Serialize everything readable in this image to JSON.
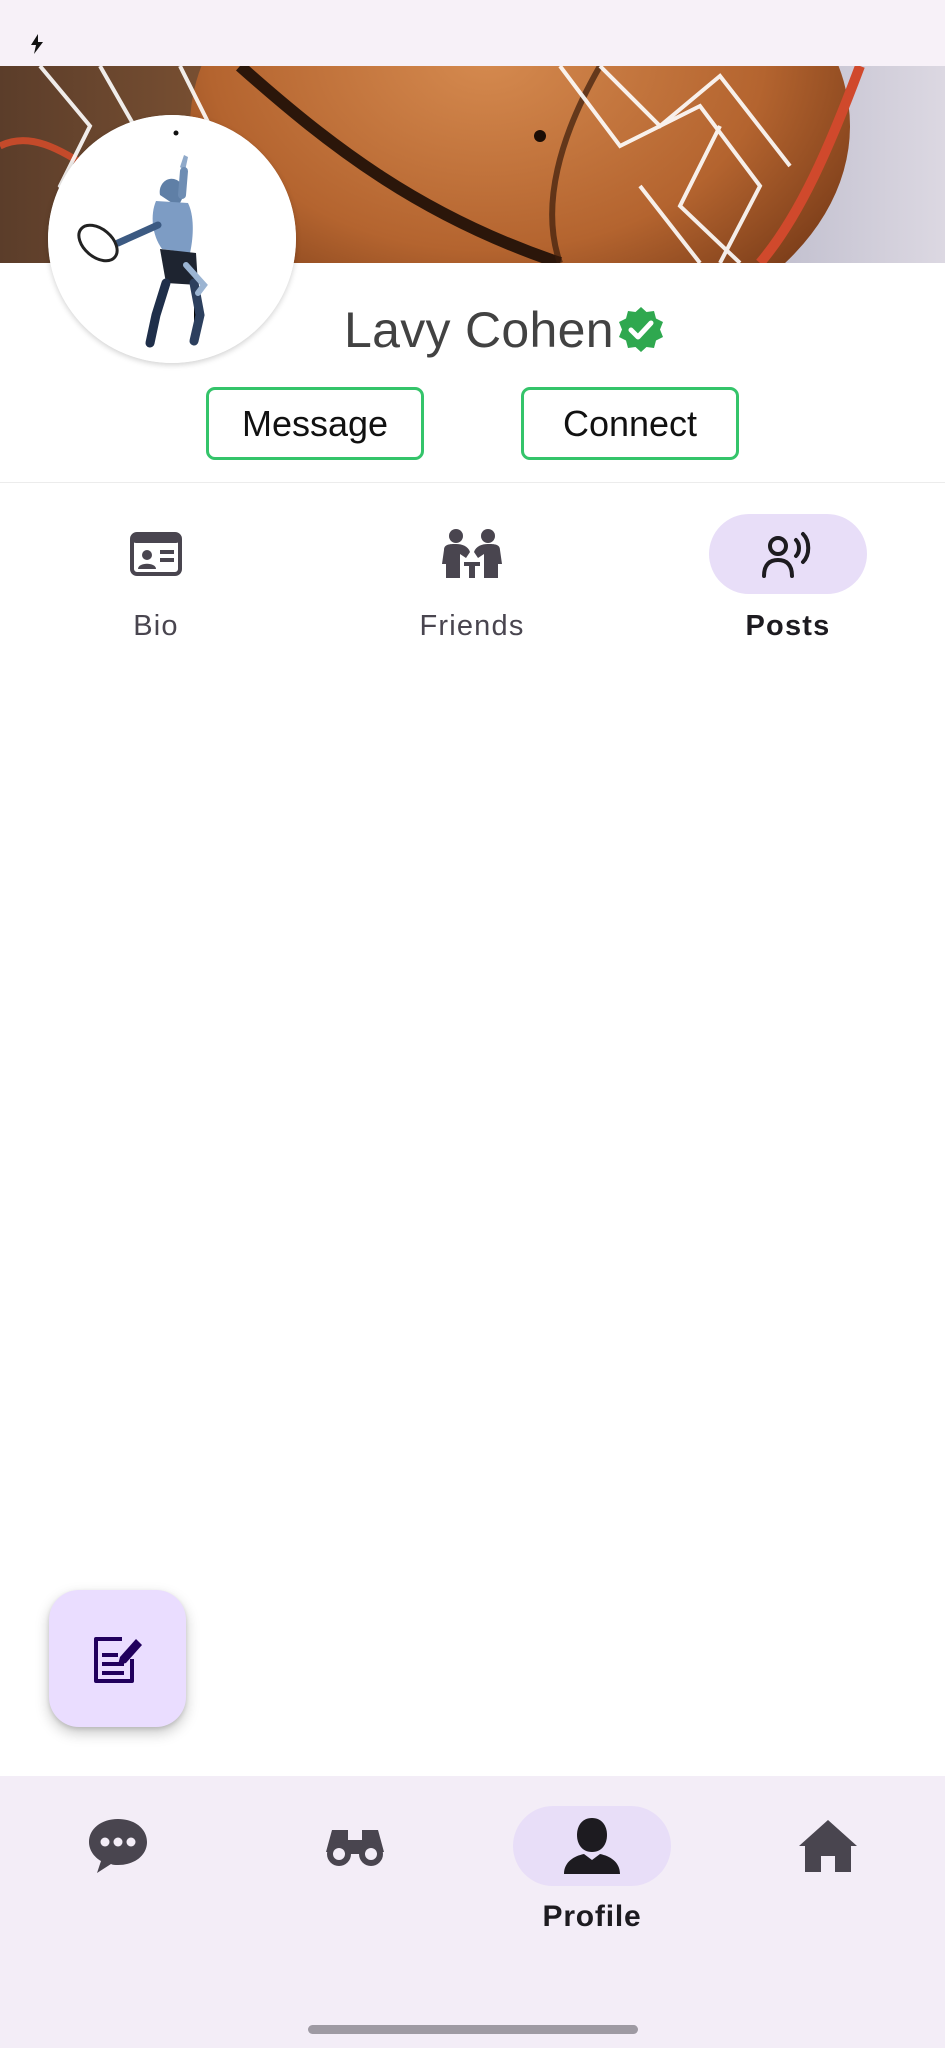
{
  "profile": {
    "name": "Lavy Cohen",
    "verified": true
  },
  "actions": {
    "message_label": "Message",
    "connect_label": "Connect"
  },
  "tabs": [
    {
      "label": "Bio",
      "icon": "id-card-icon",
      "active": false
    },
    {
      "label": "Friends",
      "icon": "friends-icon",
      "active": false
    },
    {
      "label": "Posts",
      "icon": "speaking-person-icon",
      "active": true
    }
  ],
  "fab": {
    "icon": "edit-note-icon"
  },
  "bottom_nav": [
    {
      "label": "",
      "icon": "chat-bubble-icon",
      "active": false
    },
    {
      "label": "",
      "icon": "binoculars-icon",
      "active": false
    },
    {
      "label": "Profile",
      "icon": "person-icon",
      "active": true
    },
    {
      "label": "",
      "icon": "home-icon",
      "active": false
    }
  ],
  "colors": {
    "accent_border": "#34c46a",
    "verified_badge": "#2fa84f",
    "active_pill": "#e8def8",
    "nav_background": "#f3edf7",
    "fab_background": "#eaddff"
  }
}
